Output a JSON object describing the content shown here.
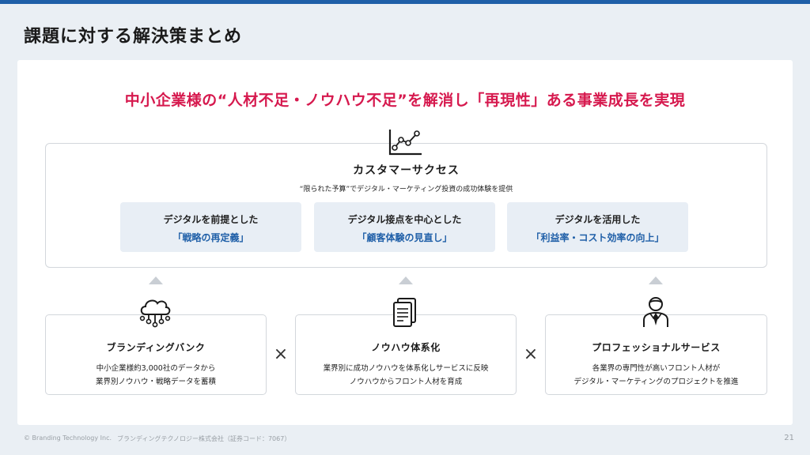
{
  "page": {
    "title": "課題に対する解決策まとめ",
    "headline": "中小企業様の“人材不足・ノウハウ不足”を解消し「再現性」ある事業成長を実現"
  },
  "customer_success": {
    "icon": "line-chart-icon",
    "title": "カスタマーサクセス",
    "subtitle": "“限られた予算”でデジタル・マーケティング投資の成功体験を提供",
    "pillars": [
      {
        "line1": "デジタルを前提とした",
        "line2": "「戦略の再定義」"
      },
      {
        "line1": "デジタル接点を中心とした",
        "line2": "「顧客体験の見直し」"
      },
      {
        "line1": "デジタルを活用した",
        "line2": "「利益率・コスト効率の向上」"
      }
    ]
  },
  "services": [
    {
      "icon": "cloud-network-icon",
      "title": "ブランディングバンク",
      "line1": "中小企業様約3,000社のデータから",
      "line2": "業界別ノウハウ・戦略データを蓄積"
    },
    {
      "icon": "document-icon",
      "title": "ノウハウ体系化",
      "line1": "業界別に成功ノウハウを体系化しサービスに反映",
      "line2": "ノウハウからフロント人材を育成"
    },
    {
      "icon": "person-icon",
      "title": "プロフェッショナルサービス",
      "line1": "各業界の専門性が高いフロント人材が",
      "line2": "デジタル・マーケティングのプロジェクトを推進"
    }
  ],
  "operator": "×",
  "footer": {
    "copyright": "© Branding Technology Inc.",
    "company": "ブランディングテクノロジー株式会社（証券コード：7067）",
    "page_number": "21"
  },
  "colors": {
    "accent_blue": "#1f5fa8",
    "headline_red": "#d6194e",
    "background": "#eaeff4"
  }
}
